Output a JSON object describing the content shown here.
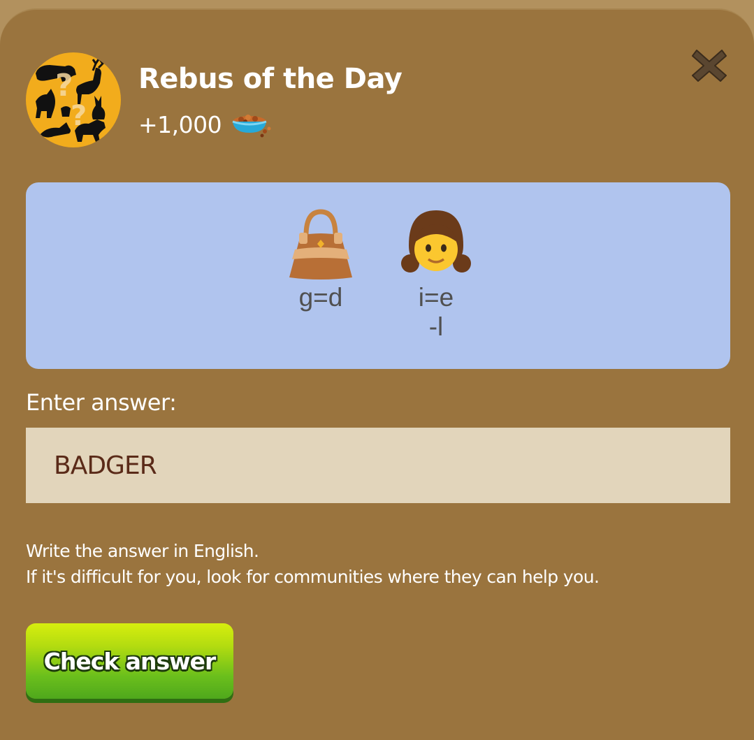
{
  "dialog": {
    "title": "Rebus of the Day",
    "reward_text": "+1,000",
    "reward_icon": "pet-food-bowl-icon",
    "close_icon": "close-icon"
  },
  "puzzle": {
    "items": [
      {
        "icon": "handbag-emoji",
        "lines": [
          "g=d"
        ]
      },
      {
        "icon": "girl-emoji",
        "lines": [
          "i=e",
          "-l"
        ]
      }
    ]
  },
  "answer": {
    "label": "Enter answer:",
    "value": "BADGER"
  },
  "hint": {
    "line1": "Write the answer in English.",
    "line2": "If it's difficult for you, look for communities where they can help you."
  },
  "actions": {
    "check_label": "Check answer"
  },
  "colors": {
    "panel": "#9a743e",
    "puzzle_bg": "#b0c4ee",
    "input_bg": "#e2d5bb",
    "avatar_bg": "#f2ac1c",
    "button_green": "#6bbf1c"
  }
}
